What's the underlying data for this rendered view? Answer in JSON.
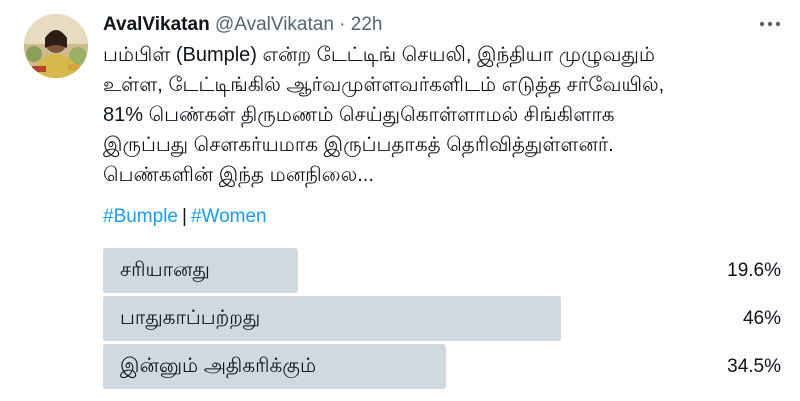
{
  "tweet": {
    "author_name": "AvalVikatan",
    "handle": "@AvalVikatan",
    "separator": "·",
    "time": "22h",
    "menu_icon": "more-dots-icon",
    "lines": [
      "பம்பிள் (Bumple) என்ற டேட்டிங் செயலி, இந்தியா முழுவதும்",
      "உள்ள, டேட்டிங்கில் ஆர்வமுள்ளவர்களிடம் எடுத்த சர்வேயில்,",
      "81% பெண்கள் திருமணம் செய்துகொள்ளாமல் சிங்கிளாக",
      "இருப்பது சௌகர்யமாக இருப்பதாகத் தெரிவித்துள்ளனர்.",
      "பெண்களின் இந்த மனநிலை..."
    ],
    "hashtags": [
      "#Bumple",
      "#Women"
    ],
    "hashtag_separator": "|"
  },
  "poll": {
    "options": [
      {
        "label": "சரியானது",
        "percent_text": "19.6%",
        "percent": 19.6
      },
      {
        "label": "பாதுகாப்பற்றது",
        "percent_text": "46%",
        "percent": 46
      },
      {
        "label": "இன்னும் அதிகரிக்கும்",
        "percent_text": "34.5%",
        "percent": 34.5
      }
    ]
  },
  "colors": {
    "text": "#0f1419",
    "secondary": "#536471",
    "link": "#1d9bf0",
    "poll_bar": "#cfd9de"
  }
}
